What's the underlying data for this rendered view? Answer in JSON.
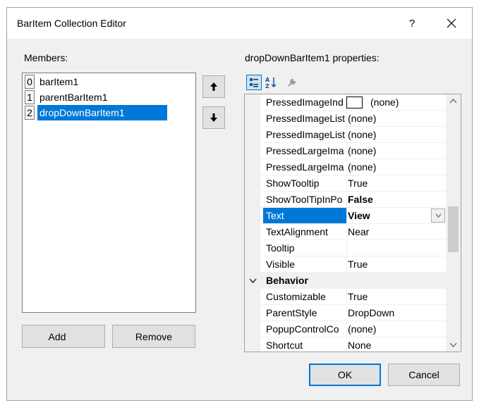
{
  "window": {
    "title": "BarItem Collection Editor",
    "help_label": "?"
  },
  "members": {
    "label": "Members:",
    "items": [
      {
        "index": "0",
        "name": "barItem1",
        "selected": false
      },
      {
        "index": "1",
        "name": "parentBarItem1",
        "selected": false
      },
      {
        "index": "2",
        "name": "dropDownBarItem1",
        "selected": true
      }
    ],
    "add_label": "Add",
    "remove_label": "Remove"
  },
  "properties": {
    "label": "dropDownBarItem1 properties:",
    "toolbar_icons": [
      "categorized-icon",
      "alphabetical-sort-icon",
      "property-pages-icon"
    ],
    "rows": [
      {
        "name": "PressedImageInd",
        "value": "(none)",
        "swatch": true
      },
      {
        "name": "PressedImageList",
        "value": "(none)"
      },
      {
        "name": "PressedImageList",
        "value": "(none)"
      },
      {
        "name": "PressedLargeIma",
        "value": "(none)"
      },
      {
        "name": "PressedLargeIma",
        "value": "(none)"
      },
      {
        "name": "ShowTooltip",
        "value": "True"
      },
      {
        "name": "ShowToolTipInPo",
        "value": "False",
        "bold": true
      },
      {
        "name": "Text",
        "value": "View",
        "bold": true,
        "selected": true
      },
      {
        "name": "TextAlignment",
        "value": "Near"
      },
      {
        "name": "Tooltip",
        "value": ""
      },
      {
        "name": "Visible",
        "value": "True"
      },
      {
        "name": "Behavior",
        "category": true
      },
      {
        "name": "Customizable",
        "value": "True"
      },
      {
        "name": "ParentStyle",
        "value": "DropDown"
      },
      {
        "name": "PopupControlCo",
        "value": "(none)"
      },
      {
        "name": "Shortcut",
        "value": "None"
      }
    ]
  },
  "buttons": {
    "ok_label": "OK",
    "cancel_label": "Cancel"
  },
  "colors": {
    "accent": "#0078d7",
    "dialog_bg": "#f0f0f0"
  }
}
